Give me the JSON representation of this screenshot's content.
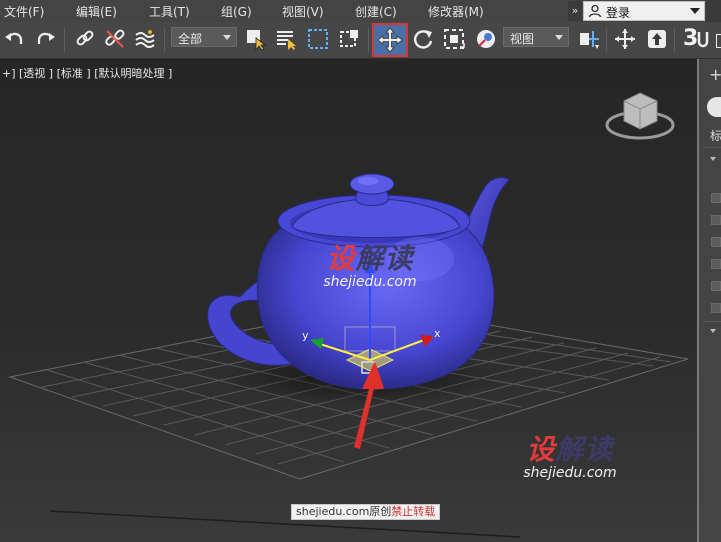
{
  "menubar": {
    "items": [
      {
        "label": "文件(F)"
      },
      {
        "label": "编辑(E)"
      },
      {
        "label": "工具(T)"
      },
      {
        "label": "组(G)"
      },
      {
        "label": "视图(V)"
      },
      {
        "label": "创建(C)"
      },
      {
        "label": "修改器(M)"
      }
    ],
    "overflow_glyph": "»",
    "login_label": "登录"
  },
  "toolbar": {
    "selection_filter": "全部",
    "coord_system": "视图",
    "snap_label": "3",
    "active_tool": "select-and-move",
    "active_color": "#4a6fa5",
    "highlight_color": "#d23a3a"
  },
  "viewport": {
    "label_plus": "+]",
    "label_view": "[透视 ]",
    "label_shading": "[标准 ]",
    "label_lighting": "[默认明暗处理 ]",
    "gizmo_x": "x",
    "gizmo_y": "y",
    "object": "teapot",
    "object_color": "#4a4ad6"
  },
  "watermarks": {
    "center_title_red": "设",
    "center_title_dark": "解读",
    "center_url": "shejiedu.com",
    "corner_title_red": "设",
    "corner_title_dark": "解读",
    "corner_url": "shejiedu.com",
    "caption_main": "shejiedu.com原创",
    "caption_red": "禁止转载"
  },
  "command_panel": {
    "create_plus": "+",
    "label_partial": "标"
  }
}
